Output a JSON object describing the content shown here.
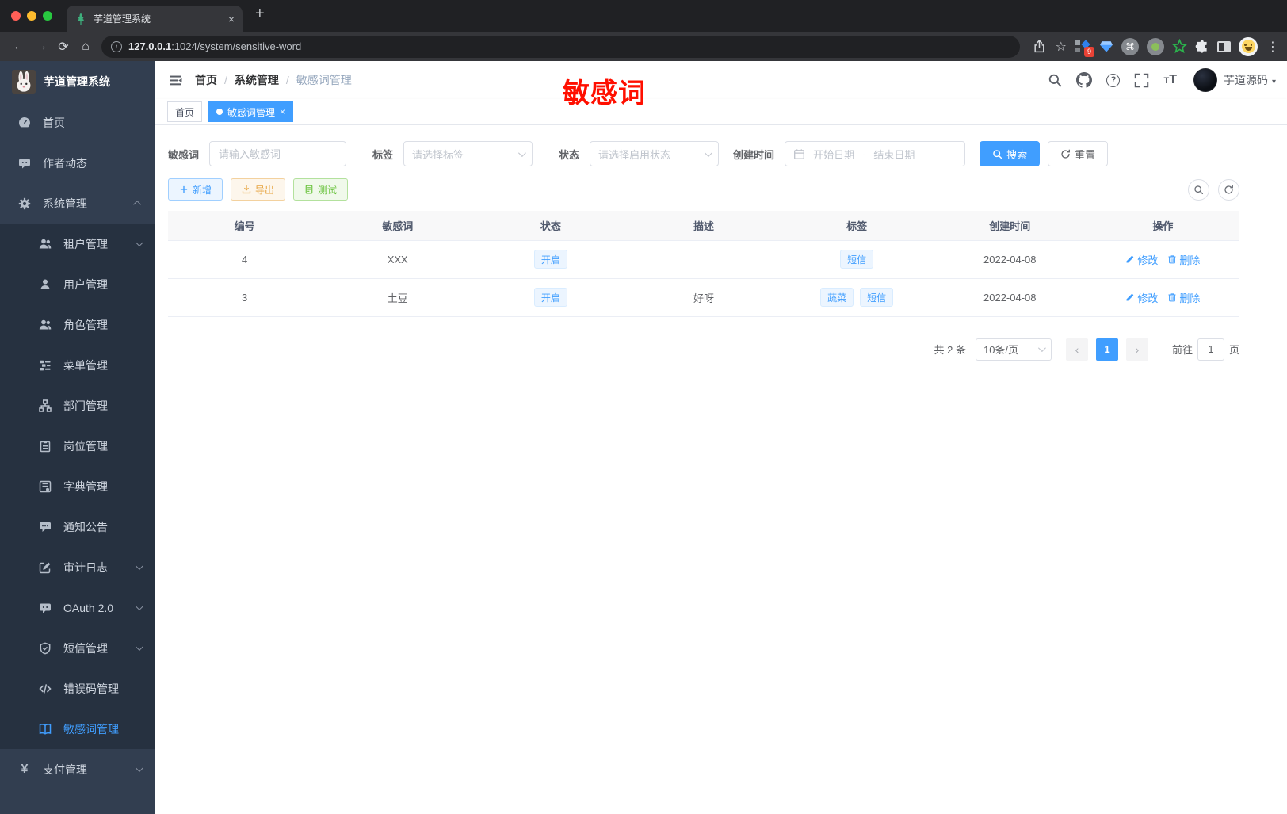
{
  "colors": {
    "primary": "#409eff",
    "success": "#67c23a",
    "warning": "#e6a23c",
    "annotation_red": "#ff0f00",
    "sidebar_bg": "#323e50",
    "sidebar_submenu_bg": "#263140",
    "tag_bg": "#ecf5ff"
  },
  "browser": {
    "tab_title": "芋道管理系统",
    "url_host": "127.0.0.1",
    "url_path": ":1024/system/sensitive-word",
    "ext_badge": "9"
  },
  "icons": {
    "back": "←",
    "forward": "→",
    "reload": "⟳",
    "home": "⌂",
    "info": "i",
    "star": "☆",
    "new_tab": "+",
    "tab_close": "×",
    "menu_dots": "⋮",
    "cmd": "⌘",
    "help": "?",
    "font_size": "T",
    "caret": "▾",
    "yen": "¥",
    "breadcrumb_sep": "/",
    "prev": "‹",
    "next": "›"
  },
  "sidebar": {
    "logo_title": "芋道管理系统",
    "items": [
      {
        "label": "首页"
      },
      {
        "label": "作者动态"
      },
      {
        "label": "系统管理"
      },
      {
        "label": "租户管理"
      },
      {
        "label": "用户管理"
      },
      {
        "label": "角色管理"
      },
      {
        "label": "菜单管理"
      },
      {
        "label": "部门管理"
      },
      {
        "label": "岗位管理"
      },
      {
        "label": "字典管理"
      },
      {
        "label": "通知公告"
      },
      {
        "label": "审计日志"
      },
      {
        "label": "OAuth 2.0"
      },
      {
        "label": "短信管理"
      },
      {
        "label": "错误码管理"
      },
      {
        "label": "敏感词管理"
      },
      {
        "label": "支付管理"
      }
    ]
  },
  "header": {
    "breadcrumb": [
      "首页",
      "系统管理",
      "敏感词管理"
    ],
    "annotation": "敏感词",
    "user_name": "芋道源码"
  },
  "tags_bar": {
    "home": "首页",
    "active": "敏感词管理"
  },
  "filters": {
    "keyword_label": "敏感词",
    "keyword_placeholder": "请输入敏感词",
    "tag_label": "标签",
    "tag_placeholder": "请选择标签",
    "status_label": "状态",
    "status_placeholder": "请选择启用状态",
    "date_label": "创建时间",
    "date_start": "开始日期",
    "date_sep": "-",
    "date_end": "结束日期",
    "search": "搜索",
    "reset": "重置"
  },
  "toolbar": {
    "add": "新增",
    "export": "导出",
    "test": "测试"
  },
  "table": {
    "headers": [
      "编号",
      "敏感词",
      "状态",
      "描述",
      "标签",
      "创建时间",
      "操作"
    ],
    "rows": [
      {
        "id": "4",
        "word": "XXX",
        "status": "开启",
        "description": "",
        "tags": [
          "短信"
        ],
        "created": "2022-04-08",
        "edit": "修改",
        "delete": "删除"
      },
      {
        "id": "3",
        "word": "土豆",
        "status": "开启",
        "description": "好呀",
        "tags": [
          "蔬菜",
          "短信"
        ],
        "created": "2022-04-08",
        "edit": "修改",
        "delete": "删除"
      }
    ]
  },
  "pagination": {
    "total": "共 2 条",
    "page_size": "10条/页",
    "page": "1",
    "goto": "前往",
    "goto_value": "1",
    "unit": "页"
  }
}
